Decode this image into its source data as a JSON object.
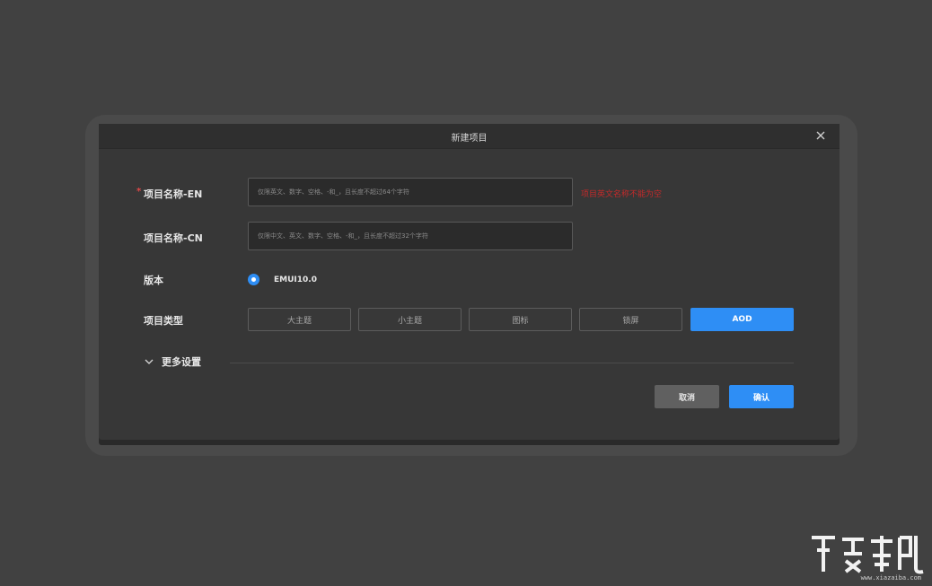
{
  "dialog": {
    "title": "新建项目",
    "close_icon": "close-icon"
  },
  "form": {
    "name_en": {
      "required_mark": "*",
      "label": "项目名称-EN",
      "placeholder": "仅限英文、数字、空格、-和_，且长度不超过64个字符",
      "value": "",
      "error": "项目英文名称不能为空"
    },
    "name_cn": {
      "label": "项目名称-CN",
      "placeholder": "仅限中文、英文、数字、空格、-和_，且长度不超过32个字符",
      "value": ""
    },
    "version": {
      "label": "版本",
      "options": [
        "EMUI10.0"
      ],
      "selected": "EMUI10.0"
    },
    "project_type": {
      "label": "项目类型",
      "options": [
        "大主题",
        "小主题",
        "图标",
        "锁屏",
        "AOD"
      ],
      "selected": "AOD"
    },
    "more_settings": {
      "label": "更多设置",
      "icon": "chevron-down-icon"
    }
  },
  "footer": {
    "cancel_label": "取消",
    "confirm_label": "确认"
  },
  "watermark": {
    "text": "www.xiazaiba.com"
  },
  "colors": {
    "background": "#414141",
    "dialog": "#373737",
    "accent": "#2e8ef5",
    "error": "#c52a2a"
  }
}
